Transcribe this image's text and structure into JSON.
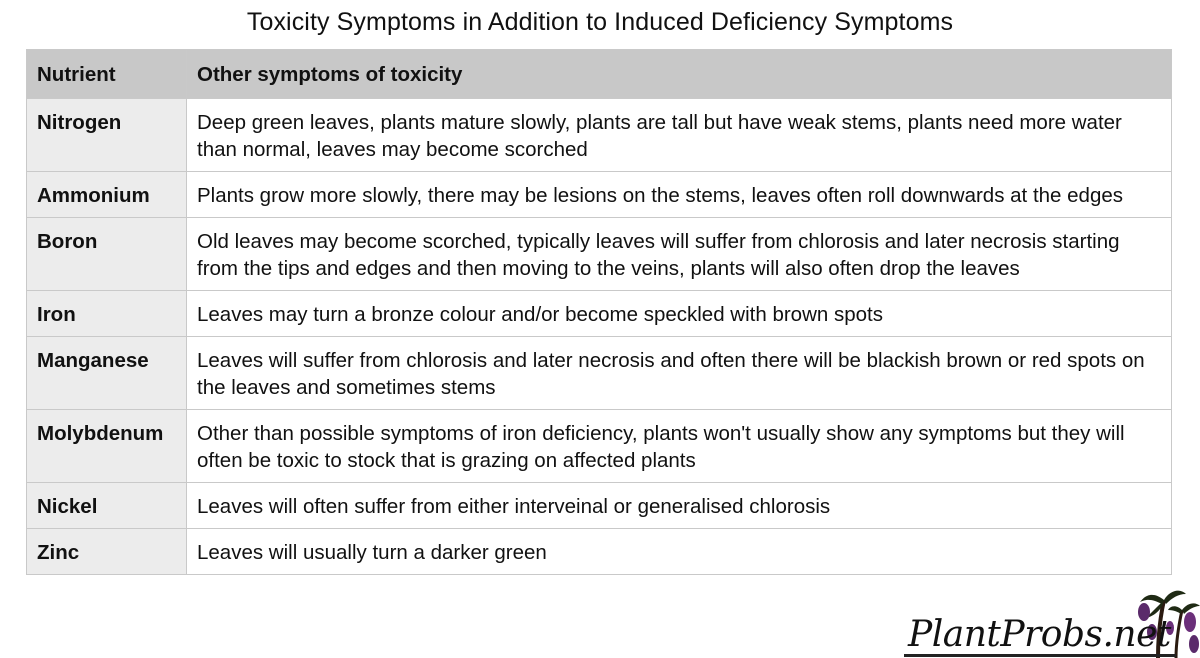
{
  "title": "Toxicity Symptoms in Addition to Induced Deficiency Symptoms",
  "table": {
    "headers": {
      "nutrient": "Nutrient",
      "symptoms": "Other symptoms of toxicity"
    },
    "rows": [
      {
        "nutrient": "Nitrogen",
        "symptoms": "Deep green leaves, plants mature slowly, plants are tall but have weak stems, plants need more water than normal, leaves may become scorched"
      },
      {
        "nutrient": "Ammonium",
        "symptoms": "Plants grow more slowly, there may be lesions on the stems, leaves often roll downwards at the edges"
      },
      {
        "nutrient": "Boron",
        "symptoms": "Old leaves may become scorched, typically leaves will suffer from chlorosis and later necrosis starting from the tips and edges and then moving to the veins, plants will also often drop the leaves"
      },
      {
        "nutrient": "Iron",
        "symptoms": "Leaves may turn a bronze colour and/or become speckled with brown spots"
      },
      {
        "nutrient": "Manganese",
        "symptoms": "Leaves will suffer from chlorosis and later necrosis and often there will be blackish brown or red spots on the leaves and sometimes stems"
      },
      {
        "nutrient": "Molybdenum",
        "symptoms": "Other than possible symptoms of iron deficiency, plants won't usually show any symptoms but they will often be toxic to stock that is grazing on affected plants"
      },
      {
        "nutrient": "Nickel",
        "symptoms": "Leaves will often suffer from either interveinal or generalised chlorosis"
      },
      {
        "nutrient": "Zinc",
        "symptoms": "Leaves will usually turn a darker green"
      }
    ]
  },
  "logo": {
    "text": "PlantProbs.net",
    "icon": "plant-logo-icon"
  },
  "colors": {
    "header_bg": "#c8c8c8",
    "nutrient_bg": "#ececec",
    "border": "#c9c9c9",
    "logo_purple": "#5a2a6a"
  }
}
